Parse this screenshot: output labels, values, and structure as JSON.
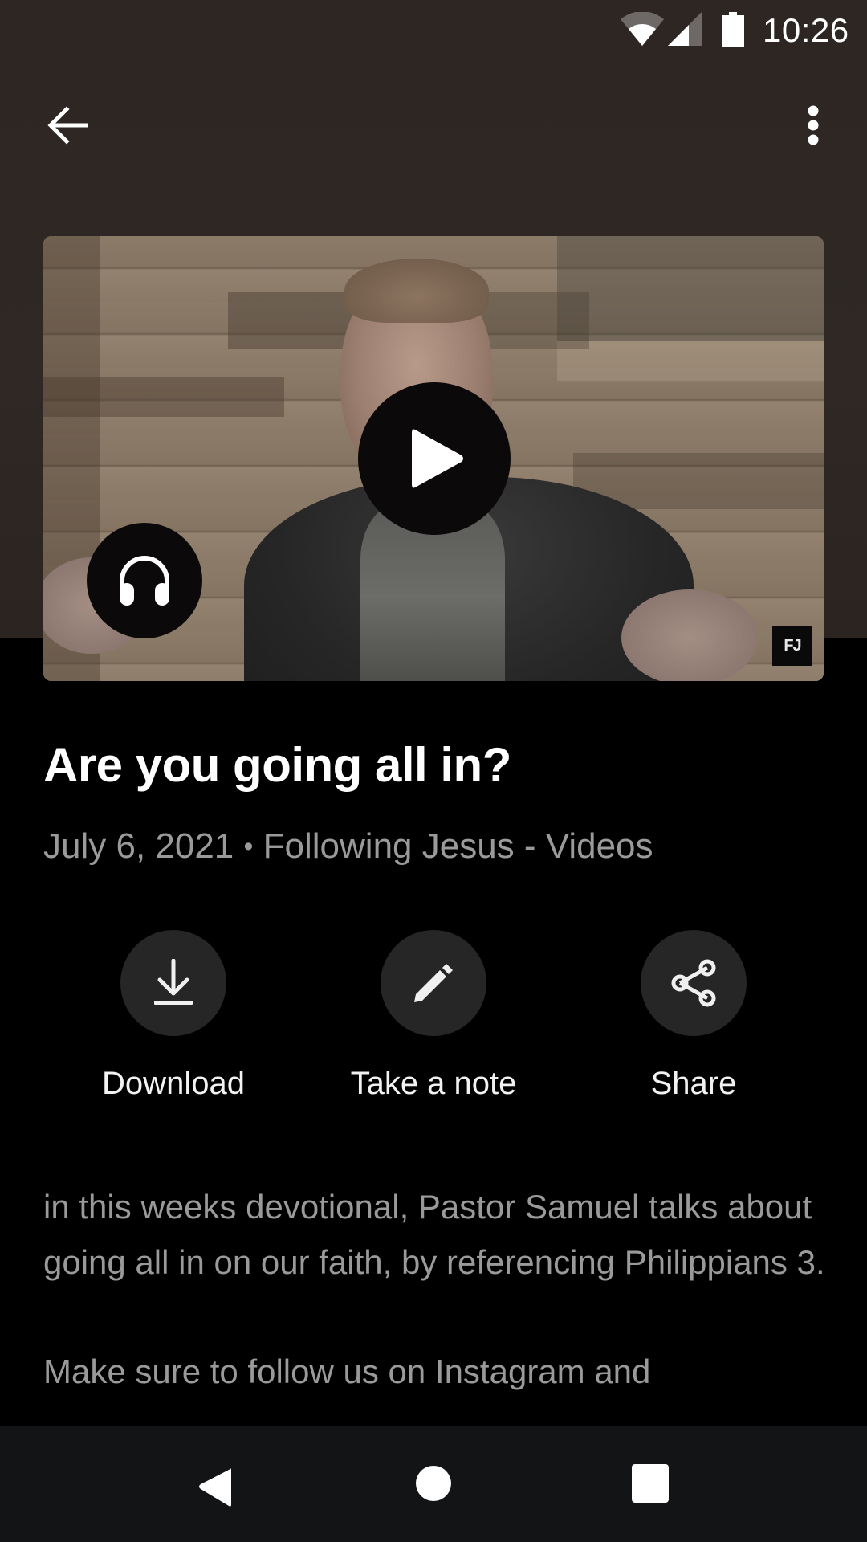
{
  "status_bar": {
    "time": "10:26",
    "icons": [
      "wifi-icon",
      "cellular-signal-icon",
      "battery-icon"
    ]
  },
  "app_bar": {
    "back_icon": "arrow-back-icon",
    "more_icon": "more-vert-icon"
  },
  "video": {
    "play_icon": "play-icon",
    "audio_icon": "headphones-icon",
    "watermark": "FJ"
  },
  "episode": {
    "title": "Are you going all in?",
    "date": "July 6, 2021",
    "separator": "•",
    "series": "Following Jesus - Videos"
  },
  "actions": [
    {
      "label": "Download",
      "icon": "download-icon"
    },
    {
      "label": "Take a note",
      "icon": "edit-pencil-icon"
    },
    {
      "label": "Share",
      "icon": "share-icon"
    }
  ],
  "description": {
    "paragraphs": [
      "in this weeks devotional, Pastor Samuel talks about going all in on our faith, by referencing Philippians 3.",
      "Make sure to follow us on Instagram and"
    ]
  },
  "nav_bar": {
    "back": "nav-back-icon",
    "home": "nav-home-icon",
    "recents": "nav-recents-icon"
  },
  "colors": {
    "header_bg": "#2e2723",
    "page_bg": "#000000",
    "action_circle": "#262626",
    "secondary_text": "#9a9a9a",
    "nav_bar_bg": "#131416"
  }
}
